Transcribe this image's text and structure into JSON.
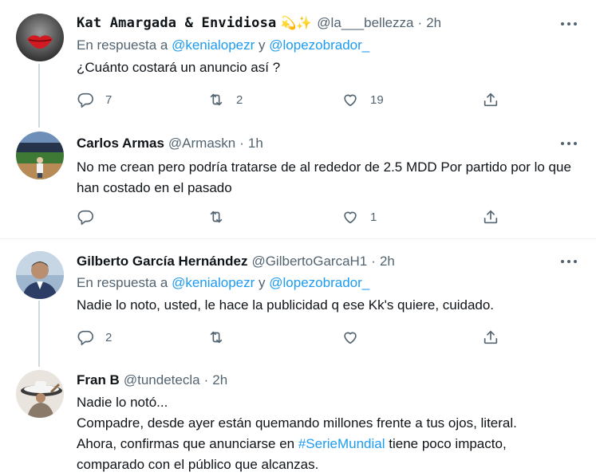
{
  "tweets": [
    {
      "name": "Kat Amargada & Envidiosa",
      "emojis": "💫✨",
      "handle": "@la___bellezza",
      "time": "2h",
      "replying_prefix": "En respuesta a",
      "replying_to_1": "@kenialopezr",
      "replying_joiner": "y",
      "replying_to_2": "@lopezobrador_",
      "text": "¿Cuánto costará un anuncio así ?",
      "replies": "7",
      "retweets": "2",
      "likes": "19"
    },
    {
      "name": "Carlos Armas",
      "handle": "@Armaskn",
      "time": "1h",
      "text": "No me crean pero podría tratarse de al rededor de 2.5 MDD Por partido por lo que han costado en el pasado",
      "replies": "",
      "retweets": "",
      "likes": "1"
    },
    {
      "name": "Gilberto García Hernández",
      "handle": "@GilbertoGarcaH1",
      "time": "2h",
      "replying_prefix": "En respuesta a",
      "replying_to_1": "@kenialopezr",
      "replying_joiner": "y",
      "replying_to_2": "@lopezobrador_",
      "text": "Nadie lo noto, usted, le hace la publicidad q ese Kk's quiere, cuidado.",
      "replies": "2",
      "retweets": "",
      "likes": ""
    },
    {
      "name": "Fran B",
      "handle": "@tundetecla",
      "time": "2h",
      "line1": "Nadie lo notó...",
      "line2": "Compadre, desde ayer están quemando millones frente a tus ojos, literal.",
      "line3_pre": "Ahora, confirmas que anunciarse en ",
      "hashtag": "#SerieMundial",
      "line3_post": " tiene poco impacto,",
      "line4": "comparado con el público que alcanzas."
    }
  ],
  "colors": {
    "text": "#0f1419",
    "secondary": "#536471",
    "link": "#1d9bf0",
    "thread_line": "#cfd9de",
    "divider": "#eff3f4"
  },
  "icons": [
    "more-icon",
    "reply-icon",
    "retweet-icon",
    "like-icon",
    "share-icon"
  ]
}
